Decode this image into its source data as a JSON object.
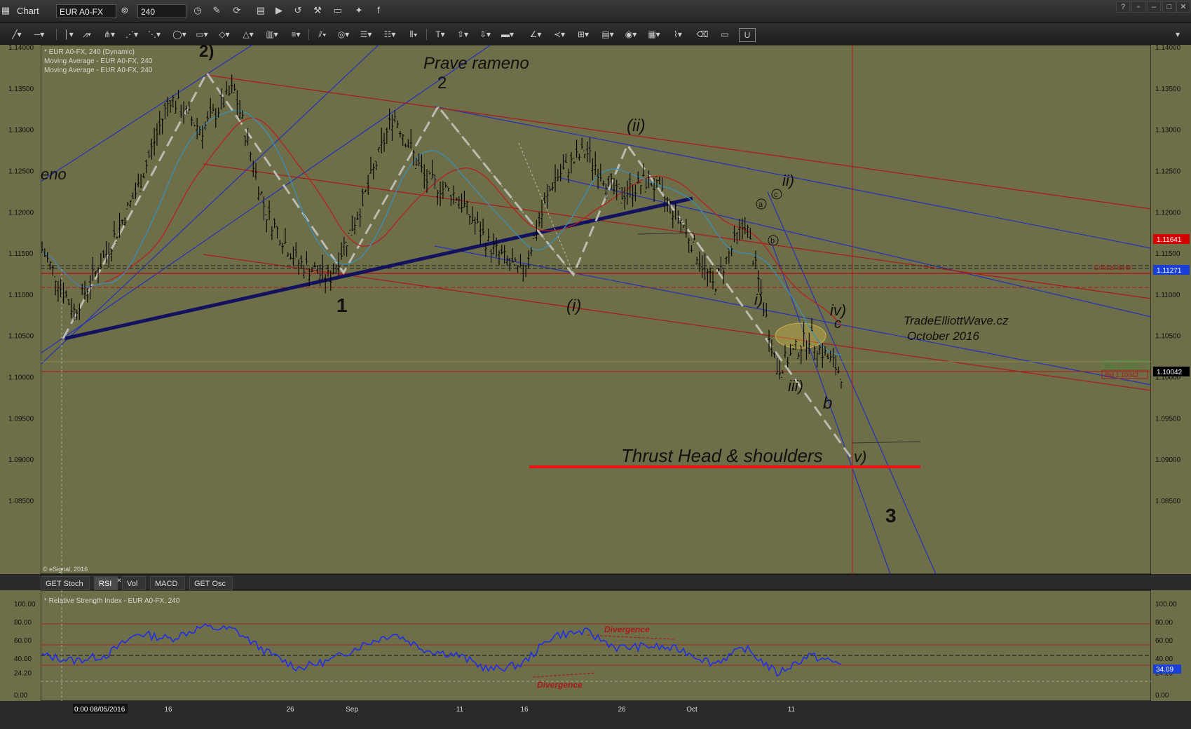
{
  "window": {
    "app_title": "Chart",
    "symbol": "EUR A0-FX",
    "interval": "240"
  },
  "legend": {
    "line1": "* EUR A0-FX, 240 (Dynamic)",
    "line2": "Moving Average - EUR A0-FX, 240",
    "line3": "Moving Average - EUR A0-FX, 240"
  },
  "copyright": "© eSignal, 2016",
  "price_axis": {
    "ticks": [
      "1.14000",
      "1.13500",
      "1.13000",
      "1.12500",
      "1.12000",
      "1.11500",
      "1.11000",
      "1.10500",
      "1.10000",
      "1.09500",
      "1.09000",
      "1.08500"
    ],
    "tag_red": "1.11641",
    "tag_blue": "1.11271",
    "tag_black": "1.10042",
    "ask": "Ask 1.10062",
    "bid": "Bid 1.10042",
    "colors": {
      "red": "#d40000",
      "blue": "#1a3fd6",
      "black": "#000000"
    }
  },
  "annotations": {
    "prave_rameno": "Prave rameno",
    "eno": "eno",
    "w2_paren": "2)",
    "w2": "2",
    "w1": "1",
    "wi": "(i)",
    "wii": "(ii)",
    "ii_small": "ii)",
    "i_small": "i)",
    "iii_small": "iii)",
    "iv_small": "iv)",
    "v_small": "v)",
    "c_small": "c",
    "b_small": "b",
    "a_circle": "a",
    "b_circle": "b",
    "c_circle": "c",
    "w3": "3",
    "critical": "Critical level",
    "tew_name": "TradeElliottWave.cz",
    "tew_date": "October  2016",
    "thrust": "Thrust  Head & shoulders"
  },
  "rsi_pane": {
    "tabs": [
      "GET Stoch",
      "RSI",
      "Vol",
      "MACD",
      "GET Osc"
    ],
    "active_tab": "RSI",
    "title": "* Relative Strength Index - EUR A0-FX, 240",
    "ticks": [
      "100.00",
      "80.00",
      "60.00",
      "40.00",
      "24.20",
      "0.00"
    ],
    "right_ticks": [
      "100.00",
      "80.00",
      "60.00",
      "40.00",
      "24.20",
      "0.00"
    ],
    "current": "34.09",
    "divergence_top": "Divergence",
    "divergence_bottom": "Divergence"
  },
  "time_axis": {
    "start": "0:00 08/05/2016",
    "labels": [
      "16",
      "26",
      "Sep",
      "11",
      "16",
      "26",
      "Oct",
      "11"
    ]
  },
  "chart_data": {
    "type": "line",
    "symbol": "EUR A0-FX",
    "interval": "240",
    "main": {
      "ylim": [
        1.08,
        1.1405
      ],
      "series": [
        {
          "x": [
            "Aug 5",
            "Aug 9",
            "Aug 11",
            "Aug 15",
            "Aug 18",
            "Aug 21",
            "Aug 24",
            "Aug 27",
            "Aug 30",
            "Sep 2",
            "Sep 5",
            "Sep 8",
            "Sep 11",
            "Sep 14",
            "Sep 17",
            "Sep 20",
            "Sep 23",
            "Sep 26",
            "Sep 29",
            "Oct 2",
            "Oct 5",
            "Oct 8",
            "Oct 10",
            "Oct 12",
            "Oct 14",
            "Oct 15"
          ],
          "values": [
            1.1155,
            1.108,
            1.115,
            1.123,
            1.134,
            1.13,
            1.135,
            1.12,
            1.114,
            1.112,
            1.121,
            1.132,
            1.124,
            1.122,
            1.116,
            1.1125,
            1.124,
            1.1275,
            1.122,
            1.124,
            1.119,
            1.111,
            1.119,
            1.101,
            1.105,
            1.1005
          ]
        }
      ]
    },
    "rsi": {
      "ylim": [
        0,
        100
      ],
      "series": [
        {
          "x": [
            "Aug 5",
            "Aug 9",
            "Aug 12",
            "Aug 15",
            "Aug 18",
            "Aug 21",
            "Aug 24",
            "Aug 27",
            "Aug 30",
            "Sep 2",
            "Sep 5",
            "Sep 8",
            "Sep 11",
            "Sep 14",
            "Sep 17",
            "Sep 20",
            "Sep 23",
            "Sep 26",
            "Sep 29",
            "Oct 2",
            "Oct 5",
            "Oct 8",
            "Oct 10",
            "Oct 12",
            "Oct 14",
            "Oct 15"
          ],
          "values": [
            44,
            38,
            44,
            68,
            62,
            75,
            72,
            48,
            30,
            38,
            55,
            68,
            50,
            44,
            28,
            34,
            66,
            70,
            52,
            54,
            50,
            35,
            52,
            24,
            44,
            34.09
          ]
        }
      ]
    }
  }
}
